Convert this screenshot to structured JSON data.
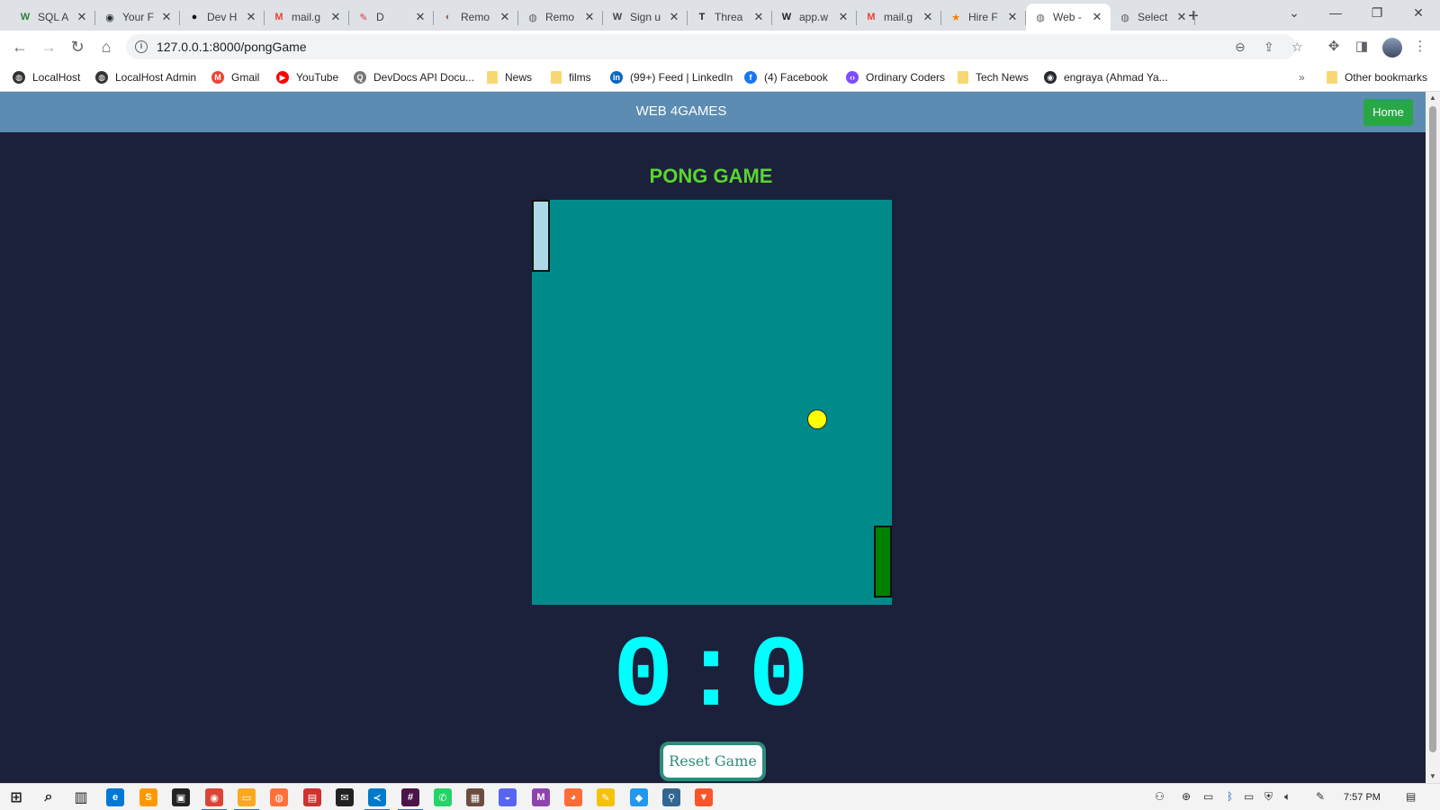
{
  "browser": {
    "tabs": [
      {
        "label": "SQL A",
        "icon": "w-icon",
        "fav_color": "#2e7d32",
        "fav_text": "W"
      },
      {
        "label": "Your F",
        "icon": "github-icon",
        "fav_color": "#24292e",
        "fav_text": "◉"
      },
      {
        "label": "Dev H",
        "icon": "devhub-icon",
        "fav_color": "#111111",
        "fav_text": "●"
      },
      {
        "label": "mail.g",
        "icon": "gmail-icon",
        "fav_color": "#ea4335",
        "fav_text": "M"
      },
      {
        "label": "D",
        "icon": "pencil-icon",
        "fav_color": "#e53935",
        "fav_text": "✎"
      },
      {
        "label": "Remo",
        "icon": "remote-icon",
        "fav_color": "#8d6e63",
        "fav_text": "◐"
      },
      {
        "label": "Remo",
        "icon": "globe-icon",
        "fav_color": "#5f6368",
        "fav_text": "◍"
      },
      {
        "label": "Sign u",
        "icon": "wikipedia-icon",
        "fav_color": "#444444",
        "fav_text": "W"
      },
      {
        "label": "Threa",
        "icon": "tr-icon",
        "fav_color": "#222222",
        "fav_text": "T"
      },
      {
        "label": "app.w",
        "icon": "w-letter-icon",
        "fav_color": "#222222",
        "fav_text": "W"
      },
      {
        "label": "mail.g",
        "icon": "gmail-icon",
        "fav_color": "#ea4335",
        "fav_text": "M"
      },
      {
        "label": "Hire F",
        "icon": "star-icon",
        "fav_color": "#f57c00",
        "fav_text": "★"
      },
      {
        "label": "Web -",
        "icon": "globe-icon",
        "fav_color": "#5f6368",
        "fav_text": "◍",
        "active": true
      },
      {
        "label": "Select",
        "icon": "globe-icon",
        "fav_color": "#5f6368",
        "fav_text": "◍"
      }
    ],
    "new_tab": "+",
    "url": "127.0.0.1:8000/pongGame",
    "bookmarks": [
      {
        "label": "LocalHost",
        "icon": "globe-icon",
        "color": "#333333",
        "glyph": "◍"
      },
      {
        "label": "LocalHost Admin",
        "icon": "globe-icon",
        "color": "#333333",
        "glyph": "◍"
      },
      {
        "label": "Gmail",
        "icon": "gmail-icon",
        "color": "#ea4335",
        "glyph": "M"
      },
      {
        "label": "YouTube",
        "icon": "youtube-icon",
        "color": "#ff0000",
        "glyph": "▶"
      },
      {
        "label": "DevDocs API Docu...",
        "icon": "devdocs-icon",
        "color": "#777777",
        "glyph": "Q"
      },
      {
        "label": "News",
        "icon": "folder-icon",
        "folder": true
      },
      {
        "label": "films",
        "icon": "folder-icon",
        "folder": true
      },
      {
        "label": "(99+) Feed | LinkedIn",
        "icon": "linkedin-icon",
        "color": "#0a66c2",
        "glyph": "in"
      },
      {
        "label": "(4) Facebook",
        "icon": "facebook-icon",
        "color": "#1877f2",
        "glyph": "f"
      },
      {
        "label": "Ordinary Coders",
        "icon": "code-icon",
        "color": "#7c4dff",
        "glyph": "‹›"
      },
      {
        "label": "Tech News",
        "icon": "folder-icon",
        "folder": true
      },
      {
        "label": "engraya (Ahmad Ya...",
        "icon": "github-icon",
        "color": "#24292e",
        "glyph": "◉"
      }
    ],
    "bookmarks_overflow": "»",
    "other_bookmarks": "Other bookmarks"
  },
  "site": {
    "brand": "WEB 4GAMES",
    "home_label": "Home"
  },
  "game": {
    "title": "PONG GAME",
    "score_left": 0,
    "score_right": 0,
    "score_sep": ":",
    "reset_label": "Reset Game",
    "colors": {
      "board": "#008b8b",
      "left_paddle": "#add8e6",
      "right_paddle": "#008000",
      "ball": "#ffff00",
      "score": "#00ffff",
      "title": "#5ad52e"
    }
  },
  "taskbar": {
    "apps": [
      {
        "name": "windows-start-icon",
        "color": "#222222",
        "glyph": "⊞"
      },
      {
        "name": "search-icon",
        "color": "#222222",
        "glyph": "⌕"
      },
      {
        "name": "task-view-icon",
        "color": "#222222",
        "glyph": "▥"
      },
      {
        "name": "edge-icon",
        "color": "#0078d4",
        "glyph": "e"
      },
      {
        "name": "sublime-icon",
        "color": "#ff9800",
        "glyph": "S"
      },
      {
        "name": "store-icon",
        "color": "#222222",
        "glyph": "▣"
      },
      {
        "name": "chrome-icon",
        "color": "#db4437",
        "glyph": "◉",
        "active": true
      },
      {
        "name": "explorer-icon",
        "color": "#f9a825",
        "glyph": "▭",
        "active": true
      },
      {
        "name": "firefox-icon",
        "color": "#ff7139",
        "glyph": "◍"
      },
      {
        "name": "app-red-icon",
        "color": "#d32f2f",
        "glyph": "▤"
      },
      {
        "name": "mail-icon",
        "color": "#222222",
        "glyph": "✉"
      },
      {
        "name": "vscode-icon",
        "color": "#007acc",
        "glyph": "≺",
        "active": true
      },
      {
        "name": "slack-icon",
        "color": "#4a154b",
        "glyph": "#",
        "active": true
      },
      {
        "name": "whatsapp-icon",
        "color": "#25d366",
        "glyph": "✆"
      },
      {
        "name": "notepad-icon",
        "color": "#6d4c41",
        "glyph": "▦"
      },
      {
        "name": "discord-icon",
        "color": "#5865f2",
        "glyph": "◒"
      },
      {
        "name": "m-app-icon",
        "color": "#8e44ad",
        "glyph": "M"
      },
      {
        "name": "postman-icon",
        "color": "#ff6c37",
        "glyph": "◕"
      },
      {
        "name": "notes-icon",
        "color": "#f4c20d",
        "glyph": "✎"
      },
      {
        "name": "docker-icon",
        "color": "#2496ed",
        "glyph": "◆"
      },
      {
        "name": "postgres-icon",
        "color": "#336791",
        "glyph": "⚲"
      },
      {
        "name": "brave-icon",
        "color": "#fb542b",
        "glyph": "▼"
      }
    ],
    "clock": "7:57 PM"
  }
}
